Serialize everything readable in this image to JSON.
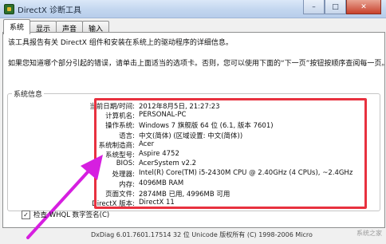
{
  "window": {
    "title": "DirectX 诊断工具",
    "minimize_icon": "minimize-icon",
    "maximize_icon": "maximize-icon",
    "close_icon": "close-icon"
  },
  "tabs": [
    {
      "label": "系统"
    },
    {
      "label": "显示"
    },
    {
      "label": "声音"
    },
    {
      "label": "输入"
    }
  ],
  "intro": {
    "line1": "该工具报告有关 DirectX 组件和安装在系统上的驱动程序的详细信息。",
    "line2": "如果您知道哪个部分引起的错误，请单击上面适当的选项卡。否则，您可以使用下面的“下一页”按钮按顺序查阅每一页。"
  },
  "system_info": {
    "group_label": "系统信息",
    "rows": [
      {
        "label": "当前日期/时间:",
        "value": "2012年8月5日, 21:27:23"
      },
      {
        "label": "计算机名:",
        "value": "PERSONAL-PC"
      },
      {
        "label": "操作系统:",
        "value": "Windows 7 旗舰版 64 位 (6.1, 版本 7601)"
      },
      {
        "label": "语言:",
        "value": "中文(简体) (区域设置: 中文(简体))"
      },
      {
        "label": "系统制造商:",
        "value": "Acer"
      },
      {
        "label": "系统型号:",
        "value": "Aspire 4752"
      },
      {
        "label": "BIOS:",
        "value": "AcerSystem v2.2"
      },
      {
        "label": "处理器:",
        "value": "Intel(R) Core(TM) i5-2430M CPU @ 2.40GHz (4 CPUs), ~2.4GHz"
      },
      {
        "label": "内存:",
        "value": "4096MB RAM"
      },
      {
        "label": "页面文件:",
        "value": "2874MB 已用, 4996MB 可用"
      },
      {
        "label": "DirectX 版本:",
        "value": "DirectX 11"
      }
    ]
  },
  "whql": {
    "label": "检查 WHQL 数字签名(C)",
    "checked": "✓"
  },
  "footer": {
    "text": "DxDiag 6.01.7601.17514 32 位 Unicode 版权所有 (C) 1998-2006 Micro"
  },
  "watermark": {
    "text": "系统之家"
  },
  "colors": {
    "highlight": "#e8313f",
    "arrow": "#d61fe0"
  }
}
